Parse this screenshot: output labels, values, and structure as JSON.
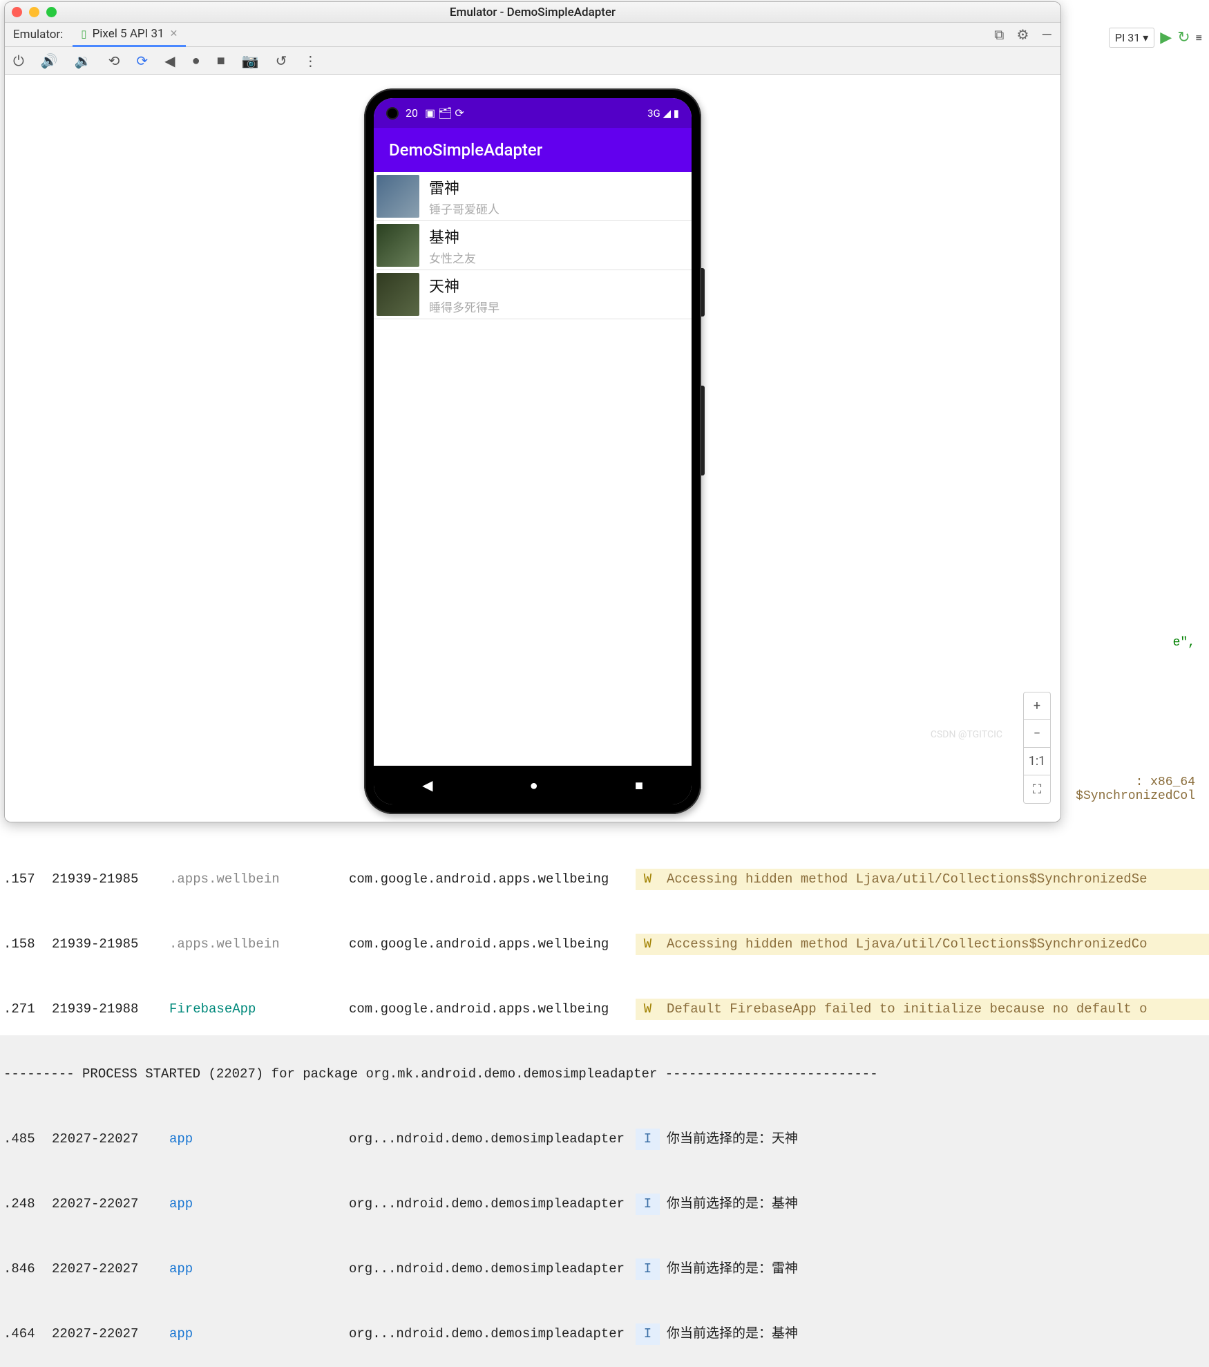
{
  "window": {
    "title": "Emulator - DemoSimpleAdapter",
    "tab_label": "Emulator:",
    "device_tab": "Pixel 5 API 31",
    "right_controls": {
      "snapshot": "⧉",
      "settings": "⚙",
      "minimize": "—"
    }
  },
  "ide_right": {
    "api": "PI 31",
    "dropdown": "▾"
  },
  "ide_code": "e\",",
  "ide_info_arch": ": x86_64",
  "ide_info_sync": "$SynchronizedCol",
  "toolbar": {
    "power": "⏻",
    "vol_up": "🔊",
    "vol_down": "🔉",
    "rotate_l": "⟲",
    "rotate_r": "⟳",
    "back": "◀",
    "dot": "●",
    "stop": "■",
    "camera": "📷",
    "reload": "↺",
    "more": "⋮"
  },
  "phone": {
    "status": {
      "time": "20",
      "icons_left": "▣  🗂  ⟳",
      "right": "3G ◢ ▮"
    },
    "app_title": "DemoSimpleAdapter",
    "items": [
      {
        "title": "雷神",
        "sub": "锤子哥爱砸人"
      },
      {
        "title": "基神",
        "sub": "女性之友"
      },
      {
        "title": "天神",
        "sub": "睡得多死得早"
      }
    ],
    "nav": {
      "back": "◀",
      "home": "●",
      "recent": "■"
    }
  },
  "zoom": {
    "plus": "+",
    "minus": "−",
    "one": "1:1",
    "fit": "⛶"
  },
  "watermark": "CSDN @TGITCIC",
  "log": {
    "rows_w": [
      {
        "t": ".157",
        "pid": "21939-21985",
        "tag": ".apps.wellbein",
        "pkg": "com.google.android.apps.wellbeing",
        "lvl": "W",
        "msg": "Accessing hidden method Ljava/util/Collections$SynchronizedSe"
      },
      {
        "t": ".158",
        "pid": "21939-21985",
        "tag": ".apps.wellbein",
        "pkg": "com.google.android.apps.wellbeing",
        "lvl": "W",
        "msg": "Accessing hidden method Ljava/util/Collections$SynchronizedCo"
      },
      {
        "t": ".271",
        "pid": "21939-21988",
        "tag": "FirebaseApp",
        "pkg": "com.google.android.apps.wellbeing",
        "lvl": "W",
        "msg": "Default FirebaseApp failed to initialize because no default o"
      }
    ],
    "divider": "--------- PROCESS STARTED (22027) for package org.mk.android.demo.demosimpleadapter ---------------------------",
    "rows_i": [
      {
        "t": ".485",
        "pid": "22027-22027",
        "tag": "app",
        "pkg": "org...ndroid.demo.demosimpleadapter",
        "lvl": "I",
        "msg": "你当前选择的是：天神"
      },
      {
        "t": ".248",
        "pid": "22027-22027",
        "tag": "app",
        "pkg": "org...ndroid.demo.demosimpleadapter",
        "lvl": "I",
        "msg": "你当前选择的是：基神"
      },
      {
        "t": ".846",
        "pid": "22027-22027",
        "tag": "app",
        "pkg": "org...ndroid.demo.demosimpleadapter",
        "lvl": "I",
        "msg": "你当前选择的是：雷神"
      },
      {
        "t": ".464",
        "pid": "22027-22027",
        "tag": "app",
        "pkg": "org...ndroid.demo.demosimpleadapter",
        "lvl": "I",
        "msg": "你当前选择的是：基神"
      }
    ]
  }
}
